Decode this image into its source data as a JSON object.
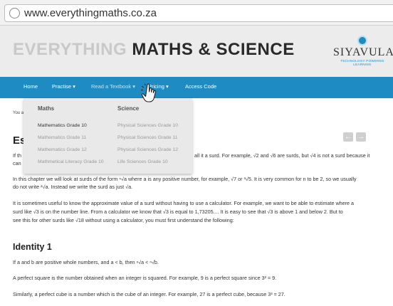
{
  "browser": {
    "url": "www.everythingmaths.co.za"
  },
  "header": {
    "logo_part1": "EVERYTHING",
    "logo_part2": "MATHS & SCIENCE",
    "brand": "SIYAVULA",
    "brand_tagline": "TECHNOLOGY POWERED LEARNING"
  },
  "nav": {
    "home": "Home",
    "practise": "Practise ▾",
    "read_textbook": "Read a Textbook ▾",
    "pricing": "Pricing ▾",
    "access_code": "Access Code"
  },
  "dropdown": {
    "maths_heading": "Maths",
    "science_heading": "Science",
    "maths_items": [
      "Mathematics Grade 10",
      "Mathematics Grade 11",
      "Mathematics Grade 12",
      "Mathmetical Literacy Grade 10"
    ],
    "science_items": [
      "Physical Sciences Grade 10",
      "Physical Sciences Grade 11",
      "Physical Sciences Grade 12",
      "Life Sciences Grade 10"
    ]
  },
  "content": {
    "breadcrumb": "You a",
    "section_title": "Es",
    "arrow_prev": "←",
    "arrow_next": "→",
    "p1_left": "If th",
    "p1_right": "all it a surd. For example, √2 and √6 are surds, but √4 is not a surd because it",
    "p1_line2": "can",
    "p2_line1": "In this chapter we will look at surds of the form ⁿ√a where a is any positive number, for example, √7 or ³√5. It is very common for n to be 2, so we usually",
    "p2_line2": "do not write ²√a. Instead we write the surd as just √a.",
    "p3_line1": "It is sometimes useful to know the approximate value of a surd without having to use a calculator. For example, we want to be able to estimate where a",
    "p3_line2": "surd like √3 is on the number line. From a calculator we know that √3 is equal to 1,73205.... It is easy to see that √3 is above 1 and below 2. But to",
    "p3_line3": "see this for other surds like √18 without using a calculator, you must first understand the following:",
    "identity_title": "Identity 1",
    "id_line1": "If a and b are positive whole numbers, and a < b, then ⁿ√a < ⁿ√b.",
    "id_line2": "A perfect square is the number obtained when an integer is squared. For example, 9 is a perfect square since 3² = 9.",
    "id_line3": "Similarly, a perfect cube is a number which is the cube of an integer. For example, 27 is a perfect cube, because 3³ = 27."
  }
}
